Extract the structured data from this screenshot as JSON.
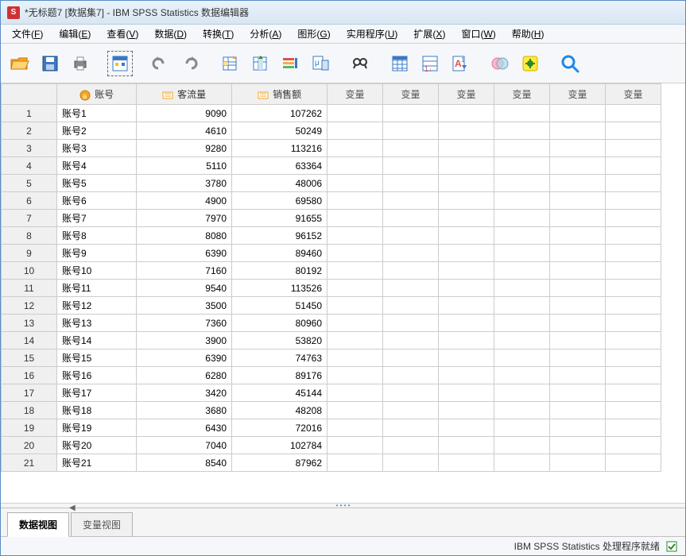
{
  "window": {
    "title": "*无标题7 [数据集7] - IBM SPSS Statistics 数据编辑器"
  },
  "menu": {
    "items": [
      {
        "label": "文件(",
        "key": "F",
        "tail": ")"
      },
      {
        "label": "编辑(",
        "key": "E",
        "tail": ")"
      },
      {
        "label": "查看(",
        "key": "V",
        "tail": ")"
      },
      {
        "label": "数据(",
        "key": "D",
        "tail": ")"
      },
      {
        "label": "转换(",
        "key": "T",
        "tail": ")"
      },
      {
        "label": "分析(",
        "key": "A",
        "tail": ")"
      },
      {
        "label": "图形(",
        "key": "G",
        "tail": ")"
      },
      {
        "label": "实用程序(",
        "key": "U",
        "tail": ")"
      },
      {
        "label": "扩展(",
        "key": "X",
        "tail": ")"
      },
      {
        "label": "窗口(",
        "key": "W",
        "tail": ")"
      },
      {
        "label": "帮助(",
        "key": "H",
        "tail": ")"
      }
    ]
  },
  "columns": {
    "account": "账号",
    "traffic": "客流量",
    "sales": "销售额",
    "var": "变量"
  },
  "rows": [
    {
      "n": "1",
      "account": "账号1",
      "traffic": "9090",
      "sales": "107262"
    },
    {
      "n": "2",
      "account": "账号2",
      "traffic": "4610",
      "sales": "50249"
    },
    {
      "n": "3",
      "account": "账号3",
      "traffic": "9280",
      "sales": "113216"
    },
    {
      "n": "4",
      "account": "账号4",
      "traffic": "5110",
      "sales": "63364"
    },
    {
      "n": "5",
      "account": "账号5",
      "traffic": "3780",
      "sales": "48006"
    },
    {
      "n": "6",
      "account": "账号6",
      "traffic": "4900",
      "sales": "69580"
    },
    {
      "n": "7",
      "account": "账号7",
      "traffic": "7970",
      "sales": "91655"
    },
    {
      "n": "8",
      "account": "账号8",
      "traffic": "8080",
      "sales": "96152"
    },
    {
      "n": "9",
      "account": "账号9",
      "traffic": "6390",
      "sales": "89460"
    },
    {
      "n": "10",
      "account": "账号10",
      "traffic": "7160",
      "sales": "80192"
    },
    {
      "n": "11",
      "account": "账号11",
      "traffic": "9540",
      "sales": "113526"
    },
    {
      "n": "12",
      "account": "账号12",
      "traffic": "3500",
      "sales": "51450"
    },
    {
      "n": "13",
      "account": "账号13",
      "traffic": "7360",
      "sales": "80960"
    },
    {
      "n": "14",
      "account": "账号14",
      "traffic": "3900",
      "sales": "53820"
    },
    {
      "n": "15",
      "account": "账号15",
      "traffic": "6390",
      "sales": "74763"
    },
    {
      "n": "16",
      "account": "账号16",
      "traffic": "6280",
      "sales": "89176"
    },
    {
      "n": "17",
      "account": "账号17",
      "traffic": "3420",
      "sales": "45144"
    },
    {
      "n": "18",
      "account": "账号18",
      "traffic": "3680",
      "sales": "48208"
    },
    {
      "n": "19",
      "account": "账号19",
      "traffic": "6430",
      "sales": "72016"
    },
    {
      "n": "20",
      "account": "账号20",
      "traffic": "7040",
      "sales": "102784"
    },
    {
      "n": "21",
      "account": "账号21",
      "traffic": "8540",
      "sales": "87962"
    }
  ],
  "tabs": {
    "data_view": "数据视图",
    "variable_view": "变量视图"
  },
  "status": {
    "text": "IBM SPSS Statistics 处理程序就绪"
  }
}
